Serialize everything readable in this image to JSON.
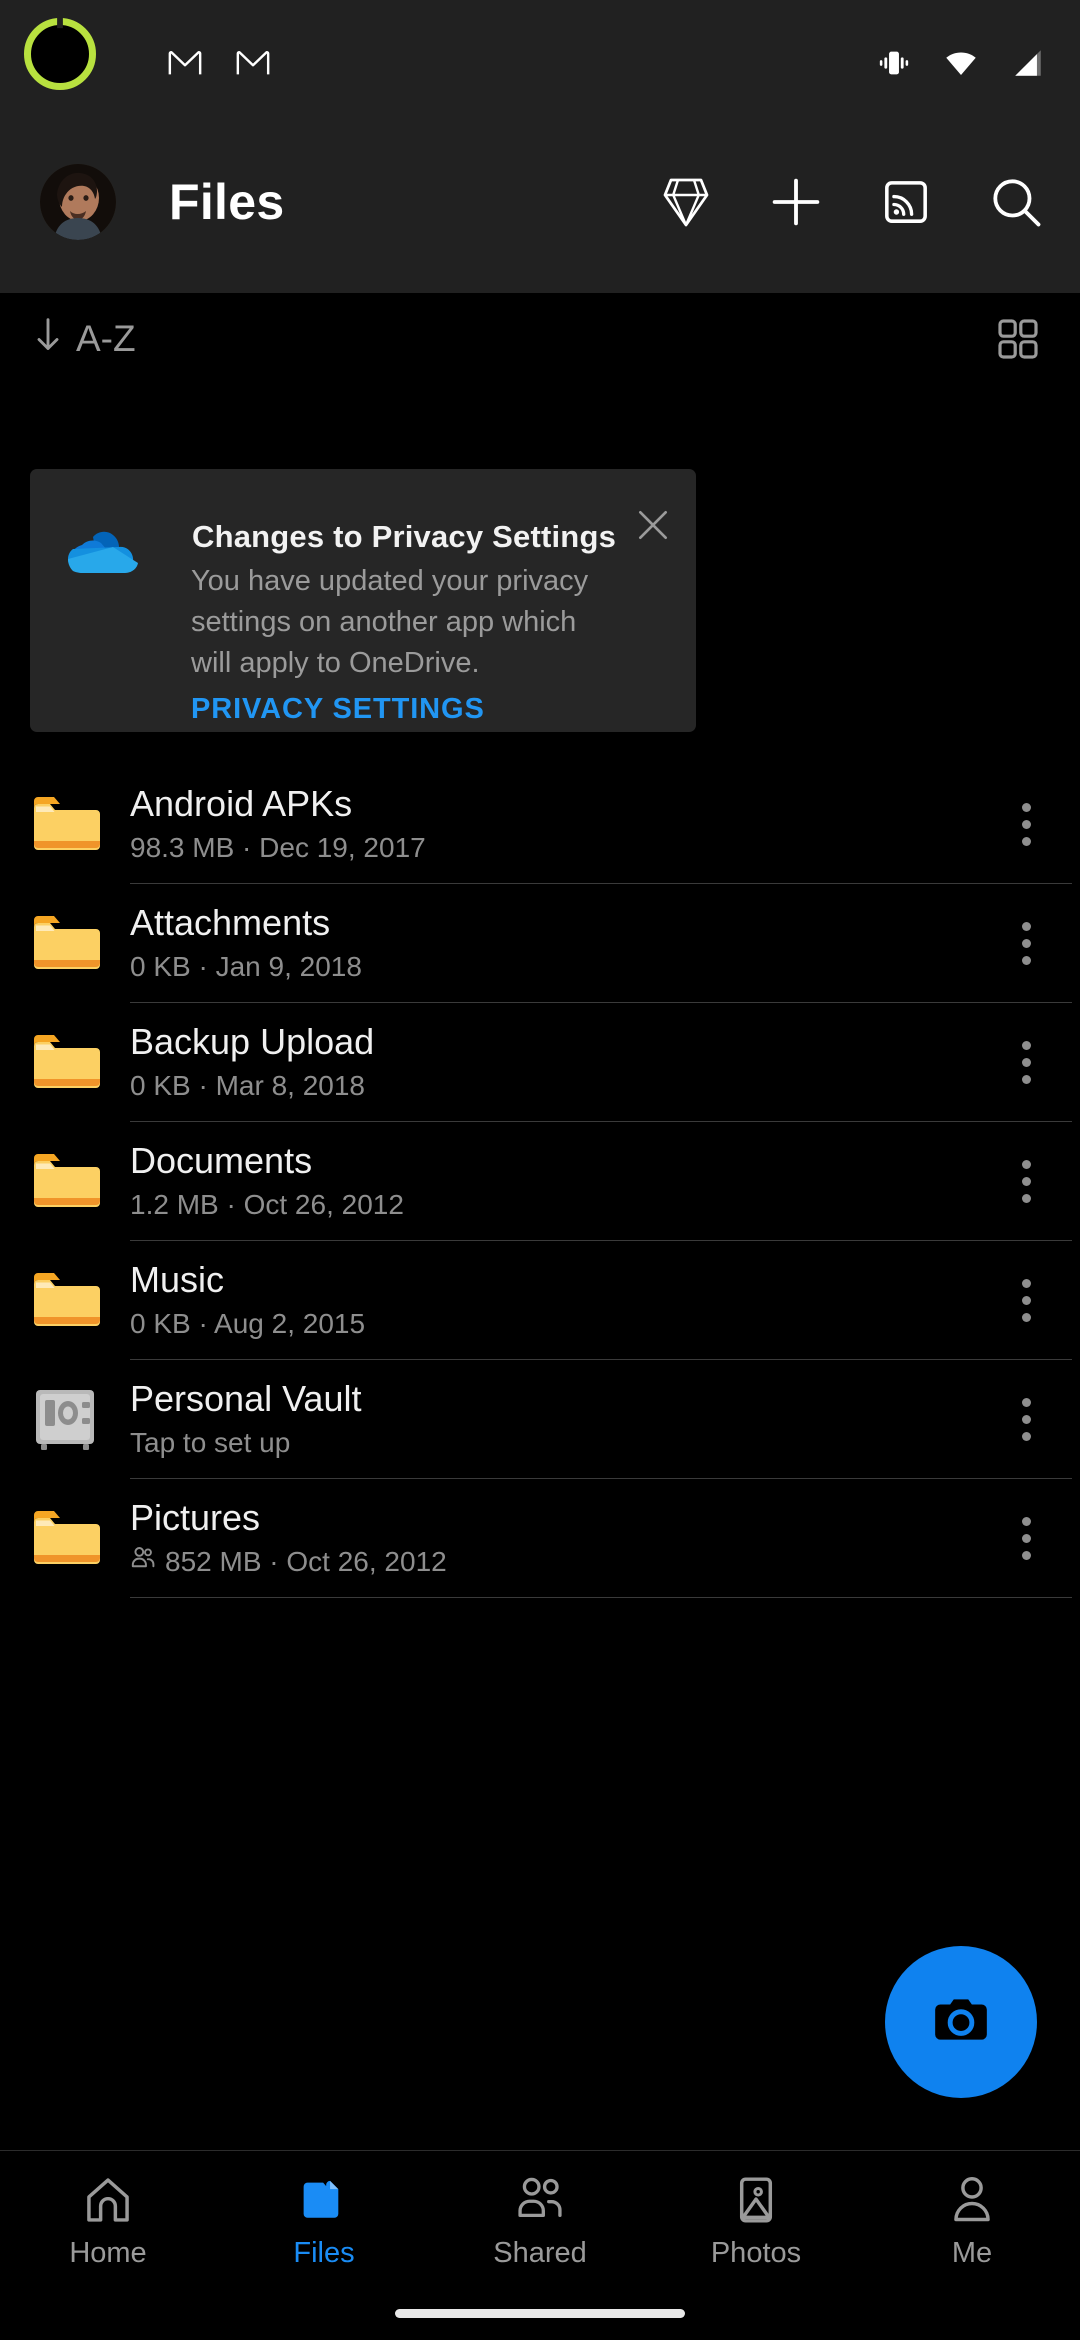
{
  "status_bar": {
    "notification_icons": [
      "gmail-icon",
      "gmail-icon"
    ],
    "right_icons": [
      "vibrate-icon",
      "wifi-icon",
      "cellular-signal-icon"
    ],
    "battery_ring_color": "#b8e13f"
  },
  "app_bar": {
    "title": "Files",
    "avatar": "user-avatar",
    "actions": [
      {
        "name": "premium-diamond-icon"
      },
      {
        "name": "add-icon"
      },
      {
        "name": "cast-icon"
      },
      {
        "name": "search-icon"
      }
    ]
  },
  "sort_bar": {
    "sort_label": "A-Z",
    "sort_direction_icon": "arrow-down-icon",
    "view_toggle_icon": "grid-view-icon"
  },
  "privacy_card": {
    "icon": "onedrive-cloud-icon",
    "title": "Changes to Privacy Settings",
    "body": "You have updated your privacy settings on another app which will apply to OneDrive.",
    "link_label": "PRIVACY SETTINGS",
    "close_icon": "close-icon",
    "link_color": "#2196f3"
  },
  "files": [
    {
      "name": "Android APKs",
      "meta": "98.3 MB · Dec 19, 2017",
      "icon": "folder-icon",
      "shared": false
    },
    {
      "name": "Attachments",
      "meta": "0 KB · Jan 9, 2018",
      "icon": "folder-icon",
      "shared": false
    },
    {
      "name": "Backup Upload",
      "meta": "0 KB · Mar 8, 2018",
      "icon": "folder-icon",
      "shared": false
    },
    {
      "name": "Documents",
      "meta": "1.2 MB · Oct 26, 2012",
      "icon": "folder-icon",
      "shared": false
    },
    {
      "name": "Music",
      "meta": "0 KB · Aug 2, 2015",
      "icon": "folder-icon",
      "shared": false
    },
    {
      "name": "Personal Vault",
      "meta": "Tap to set up",
      "icon": "vault-icon",
      "shared": false
    },
    {
      "name": "Pictures",
      "meta": "852 MB · Oct 26, 2012",
      "icon": "folder-icon",
      "shared": true
    }
  ],
  "fab": {
    "name": "camera-fab",
    "icon": "camera-icon",
    "color": "#0f82ef"
  },
  "bottom_nav": {
    "active_color": "#1a8cf5",
    "items": [
      {
        "label": "Home",
        "icon": "home-icon",
        "active": false
      },
      {
        "label": "Files",
        "icon": "folder-icon",
        "active": true
      },
      {
        "label": "Shared",
        "icon": "people-icon",
        "active": false
      },
      {
        "label": "Photos",
        "icon": "photo-icon",
        "active": false
      },
      {
        "label": "Me",
        "icon": "person-icon",
        "active": false
      }
    ]
  }
}
